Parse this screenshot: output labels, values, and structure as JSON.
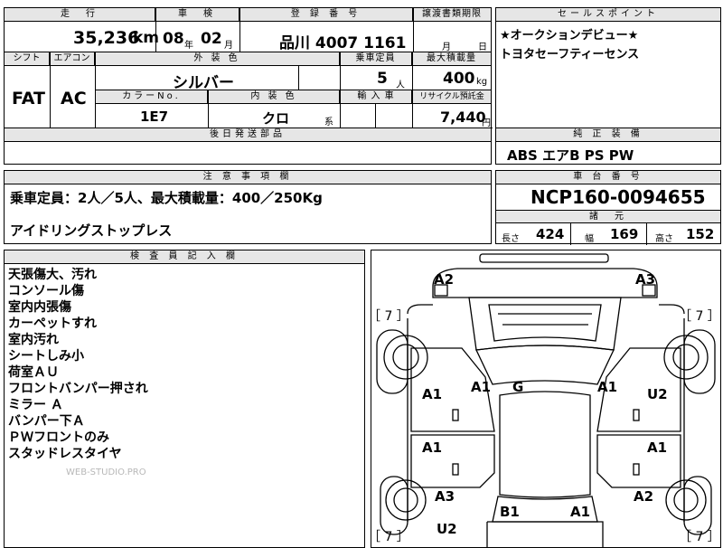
{
  "top": {
    "mileage_label": "走　行",
    "mileage_value": "35,236",
    "mileage_unit": "km",
    "inspection_label": "車　検",
    "inspection_year": "08",
    "inspection_year_unit": "年",
    "inspection_month": "02",
    "inspection_month_unit": "月",
    "registration_label": "登 録 番 号",
    "registration_value": "品川 4007 1161",
    "transfer_label": "譲渡書類期限",
    "transfer_month_unit": "月",
    "transfer_day_unit": "日"
  },
  "sales_points": {
    "label": "セールスポイント",
    "lines": [
      "★オークションデビュー★",
      "トヨタセーフティーセンス"
    ]
  },
  "row2": {
    "shift_label": "シフト",
    "shift_value": "FAT",
    "ac_label": "エアコン",
    "ac_value": "AC",
    "exterior_color_label": "外 装 色",
    "exterior_color_value": "シルバー",
    "capacity_label": "乗車定員",
    "capacity_value": "5",
    "capacity_unit": "人",
    "max_load_label": "最大積載量",
    "max_load_value": "400",
    "max_load_unit": "kg",
    "color_no_label": "カラーNo.",
    "color_no_value": "1E7",
    "interior_label": "内 装 色",
    "interior_value": "クロ",
    "interior_unit": "系",
    "import_label": "輸 入 車",
    "recycle_label": "リサイクル預託金",
    "recycle_value": "7,440",
    "recycle_unit": "円",
    "parts_label": "後日発送部品"
  },
  "equipment": {
    "label": "純 正 装 備",
    "value": "ABS エアB PS PW"
  },
  "notes": {
    "label": "注 意 事 項 欄",
    "line1": "乗車定員：2人／5人、最大積載量：400／250Kg",
    "line2": "アイドリングストップレス"
  },
  "chassis": {
    "label": "車 台 番 号",
    "value": "NCP160-0094655",
    "specs_label": "諸　元",
    "length_label": "長さ",
    "length_value": "424",
    "width_label": "幅",
    "width_value": "169",
    "height_label": "高さ",
    "height_value": "152"
  },
  "inspector": {
    "label": "検 査 員 記 入 欄",
    "lines": [
      "天張傷大、汚れ",
      "コンソール傷",
      "室内内張傷",
      "カーペットすれ",
      "室内汚れ",
      "シートしみ小",
      "荷室ＡＵ",
      "フロントバンパー押され",
      "ミラー Ａ",
      "バンパー下Ａ",
      "ＰＷフロントのみ",
      "スタッドレスタイヤ"
    ],
    "watermark": "WEB-STUDIO.PRO"
  },
  "diagram": {
    "tire_tl": "［ 7 ］",
    "tire_tr": "［ 7 ］",
    "tire_bl": "［ 7 ］",
    "tire_br": "［ 7 ］",
    "codes": {
      "front_left": "A2",
      "front_right": "A3",
      "left_front_door": "A1",
      "pillar_left": "A1",
      "roof": "G",
      "pillar_right": "A1",
      "right_front_door": "U2",
      "left_rear_door": "A1",
      "right_rear_door": "A1",
      "left_quarter": "A3",
      "right_quarter": "A2",
      "left_rear": "U2",
      "rear_left": "B1",
      "rear_right": "A1"
    }
  }
}
